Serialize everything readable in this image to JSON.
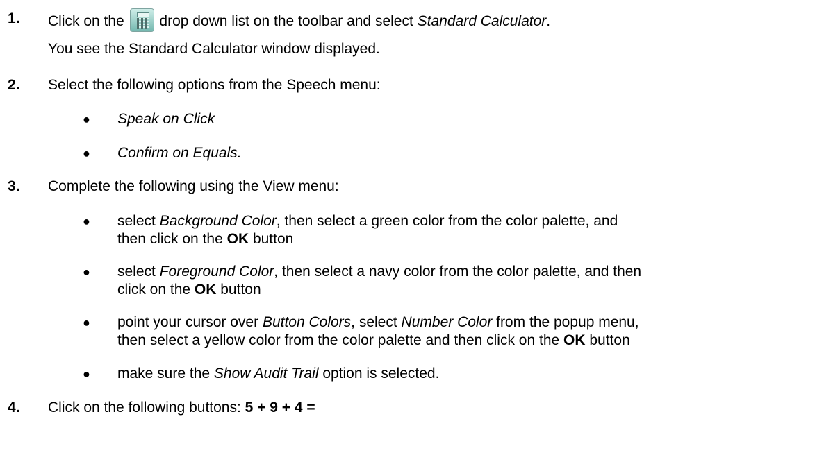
{
  "steps": [
    {
      "num": "1.",
      "parts": [
        "Click on the",
        "drop down list on the toolbar and select",
        "Standard Calculator",
        "."
      ],
      "icon": "calculator-icon",
      "note": "You see the Standard Calculator window displayed."
    },
    {
      "num": "2.",
      "text": "Select the following options from the Speech menu:",
      "bullets": [
        {
          "italic": "Speak on Click"
        },
        {
          "italic": "Confirm on Equals."
        }
      ]
    },
    {
      "num": "3.",
      "text": "Complete the following using the View menu:",
      "bullets": [
        {
          "line1": [
            "select",
            "Background Color",
            ", then select a green color from the color palette, and"
          ],
          "line2": [
            "then click on the",
            "OK",
            "button"
          ]
        },
        {
          "line1": [
            "select",
            "Foreground Color",
            ", then select a navy color from the color palette, and then"
          ],
          "line2": [
            "click on the",
            "OK",
            "button"
          ]
        },
        {
          "line1": [
            "point your cursor over",
            "Button Colors",
            ", select",
            "Number Color",
            "from the popup menu,"
          ],
          "line2": [
            "then select a yellow color from the color palette and then click on the",
            "OK",
            "button"
          ]
        },
        {
          "line1": [
            "make sure the",
            "Show Audit Trail",
            "option is selected."
          ]
        }
      ]
    },
    {
      "num": "4.",
      "text": "Click on the following buttons:",
      "bold": "5 + 9 + 4 ="
    }
  ]
}
